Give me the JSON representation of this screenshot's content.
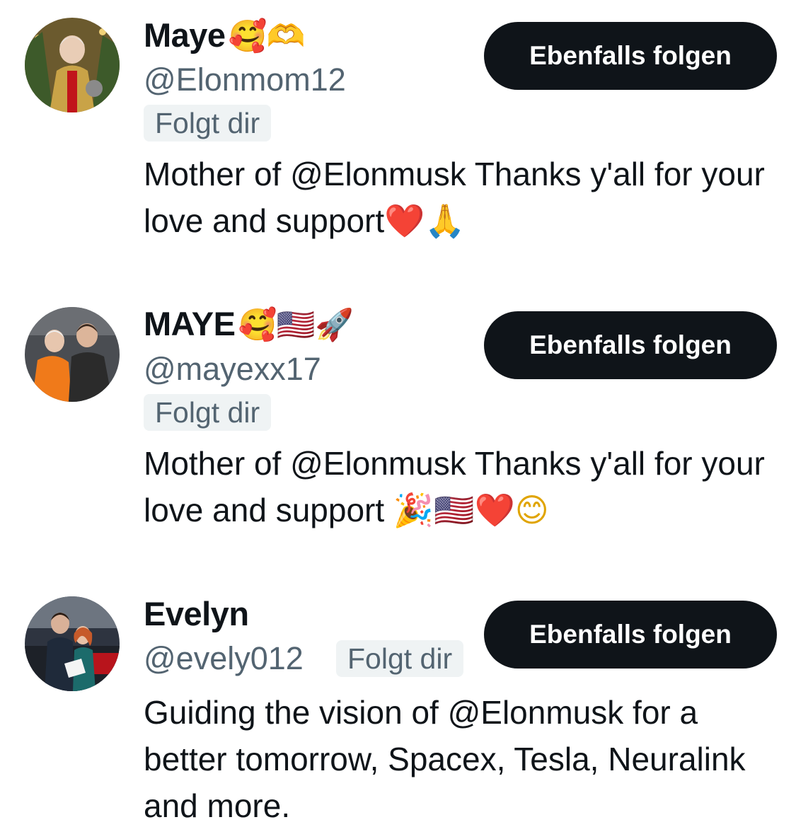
{
  "followers": [
    {
      "name": "Maye",
      "name_emojis": "🥰🫶",
      "handle": "@Elonmom12",
      "follows_badge": "Folgt dir",
      "button_label": "Ebenfalls folgen",
      "bio": "Mother of @Elonmusk Thanks y'all for your love and support",
      "bio_emojis": "❤️🙏"
    },
    {
      "name": "MAYE",
      "name_emojis": "🥰🇺🇸🚀",
      "handle": "@mayexx17",
      "follows_badge": "Folgt dir",
      "button_label": "Ebenfalls folgen",
      "bio": "Mother of @Elonmusk Thanks y'all for your love and support",
      "bio_emojis": "🎉🇺🇸❤️😊"
    },
    {
      "name": "Evelyn",
      "handle": "@evely012",
      "follows_badge": "Folgt dir",
      "button_label": "Ebenfalls folgen",
      "bio": "Guiding the vision of @Elonmusk for a better tomorrow, Spacex, Tesla, Neuralink and more."
    }
  ],
  "colors": {
    "text_primary": "#0f1419",
    "text_secondary": "#536471",
    "button_bg": "#0f1419",
    "button_text": "#ffffff",
    "badge_bg": "#eff3f4"
  }
}
